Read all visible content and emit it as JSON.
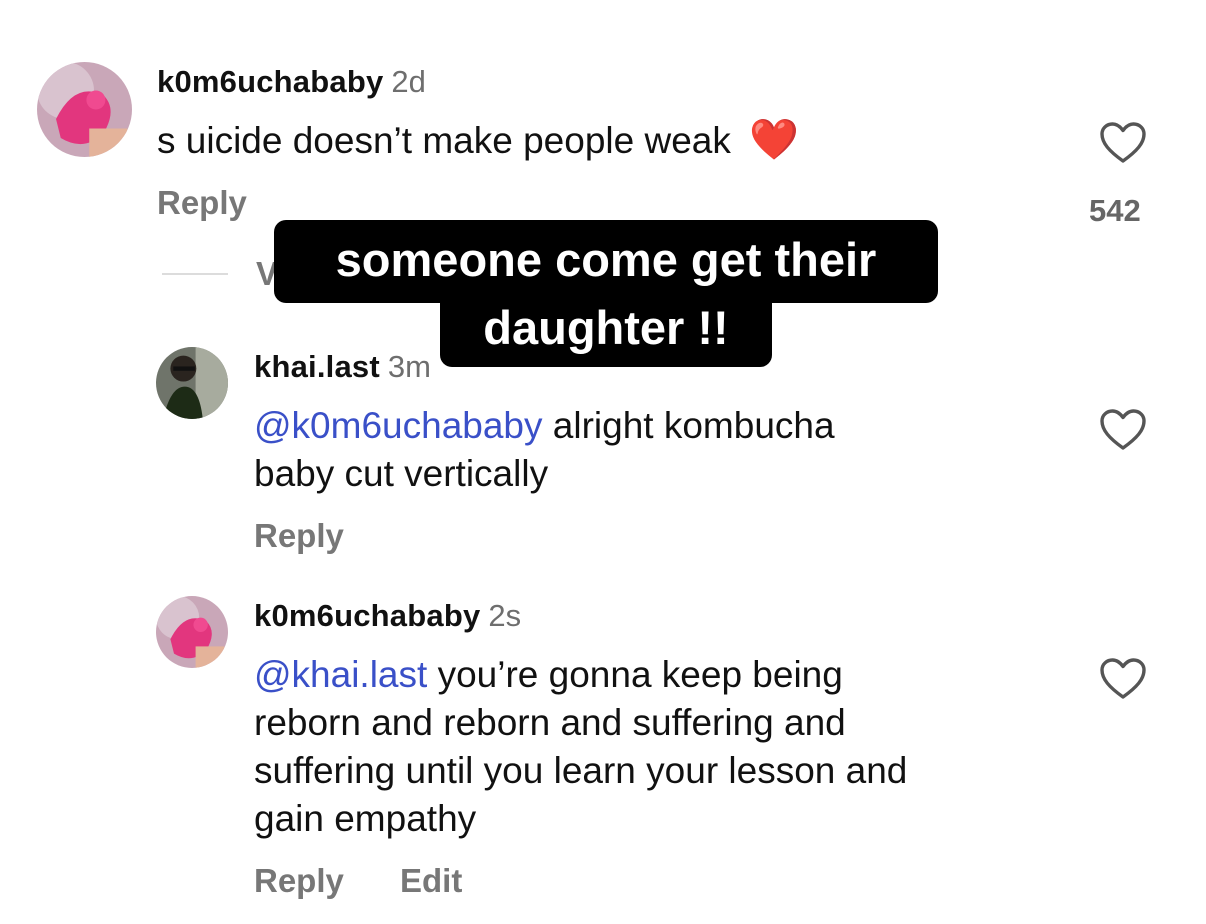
{
  "comments": [
    {
      "username": "k0m6uchababy",
      "time": "2d",
      "text": "s uicide doesn’t make people weak",
      "emoji": "❤️",
      "reply_label": "Reply",
      "like_count": "542",
      "icon": "heart-outline-icon"
    },
    {
      "username": "khai.last",
      "time": "3m",
      "mention": "@k0m6uchababy",
      "text_line1": " alright kombucha",
      "text_line2": "baby cut vertically",
      "reply_label": "Reply",
      "icon": "heart-outline-icon"
    },
    {
      "username": "k0m6uchababy",
      "time": "2s",
      "mention": "@khai.last",
      "text_line1": " you’re gonna keep being",
      "text_line2": "reborn and reborn and suffering and",
      "text_line3": "suffering until you learn your lesson and",
      "text_line4": "gain empathy",
      "reply_label": "Reply",
      "edit_label": "Edit",
      "icon": "heart-outline-icon"
    }
  ],
  "view_replies_partial": "V",
  "caption": {
    "line1": "someone come get their",
    "line2": "daughter !!"
  },
  "colors": {
    "mention": "#3a50c8",
    "secondary_text": "#777777",
    "caption_bg": "#000000"
  }
}
